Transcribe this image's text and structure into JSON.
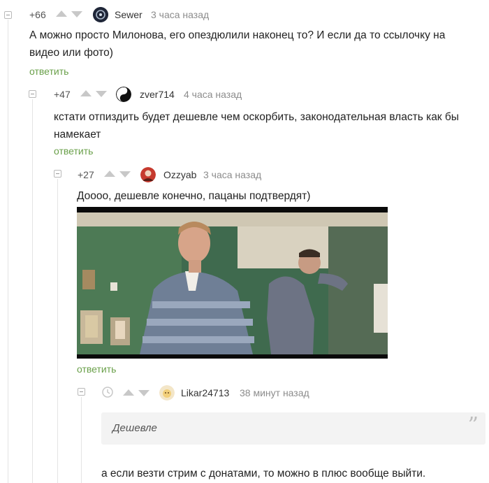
{
  "comments": [
    {
      "rating": "+66",
      "username": "Sewer",
      "time": "3 часа назад",
      "text_line1": "А можно просто Милонова, его опездюлили наконец то? И если да то ссылочку на",
      "text_line2": "видео или фото)",
      "reply_label": "ответить"
    },
    {
      "rating": "+47",
      "username": "zver714",
      "time": "4 часа назад",
      "text_line1": "кстати отпиздить будет дешевле чем оскорбить, законодательная власть как бы",
      "text_line2": "намекает",
      "reply_label": "ответить"
    },
    {
      "rating": "+27",
      "username": "Ozzyab",
      "time": "3 часа назад",
      "text_line1": "Доооо, дешевле конечно, пацаны подтвердят)",
      "reply_label": "ответить"
    },
    {
      "rating_icon": "clock-icon",
      "username": "Likar24713",
      "time": "38 минут назад",
      "quote": "Дешевле",
      "text_line1": "а если везти стрим с донатами, то можно в плюс вообще выйти."
    }
  ],
  "colors": {
    "reply": "#6aa04a",
    "meta": "#8c8c8c",
    "arrow": "#c8c8c8",
    "quote_bg": "#f3f3f3"
  }
}
